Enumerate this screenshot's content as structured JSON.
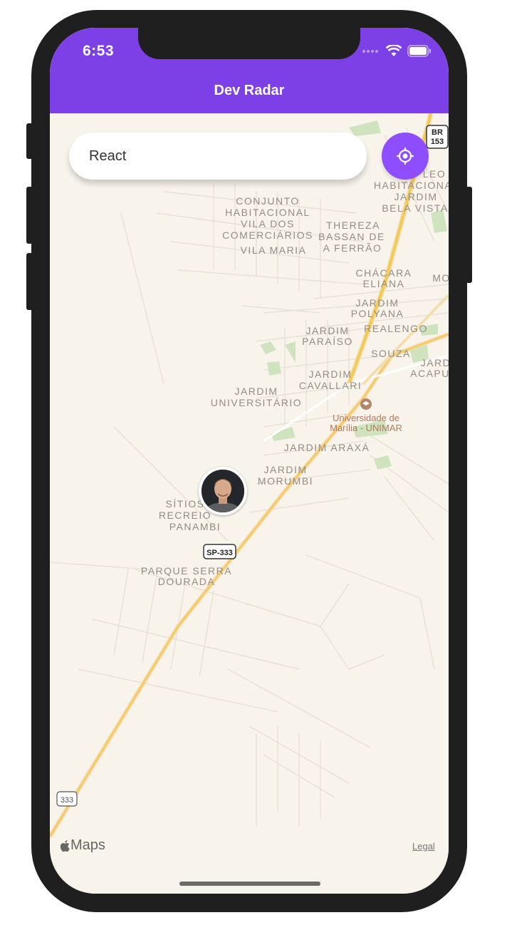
{
  "status_bar": {
    "time": "6:53"
  },
  "header": {
    "title": "Dev Radar"
  },
  "search": {
    "value": "React"
  },
  "locate_button": {
    "icon": "crosshair-icon"
  },
  "map": {
    "labels": [
      "CONJUNTO",
      "HABITACIONAL",
      "VILA DOS",
      "COMERCIÁRIOS",
      "VILA MARIA",
      "THEREZA",
      "BASSAN DE",
      "A FERRÃO",
      "CHÁCARA",
      "ELIANA",
      "JARDIM",
      "POLYANA",
      "REALENGO",
      "JARDIM",
      "PARAÍSO",
      "SOUZA",
      "JARDIM",
      "CAVALLARI",
      "JARDIM",
      "UNIVERSITÁRIO",
      "JARDIM ARAXÁ",
      "JARDIM",
      "MORUMBI",
      "SÍTIOS",
      "RECREIO",
      "PANAMBI",
      "PARQUE SERRA",
      "DOURADA",
      "LEO",
      "HABITACIONA",
      "JARDIM",
      "BELA VISTA",
      "MO",
      "JARD",
      "ACAPU"
    ],
    "poi": [
      "Universidade de",
      "Marília - UNIMAR"
    ],
    "route_shields": [
      "BR",
      "153",
      "SP-333",
      "333"
    ]
  },
  "footer": {
    "maps_label": "Maps",
    "legal": "Legal"
  },
  "colors": {
    "accent": "#7d40e7",
    "button": "#8e4dff",
    "map_bg": "#f8f4ec",
    "highway": "#f5c85a"
  }
}
